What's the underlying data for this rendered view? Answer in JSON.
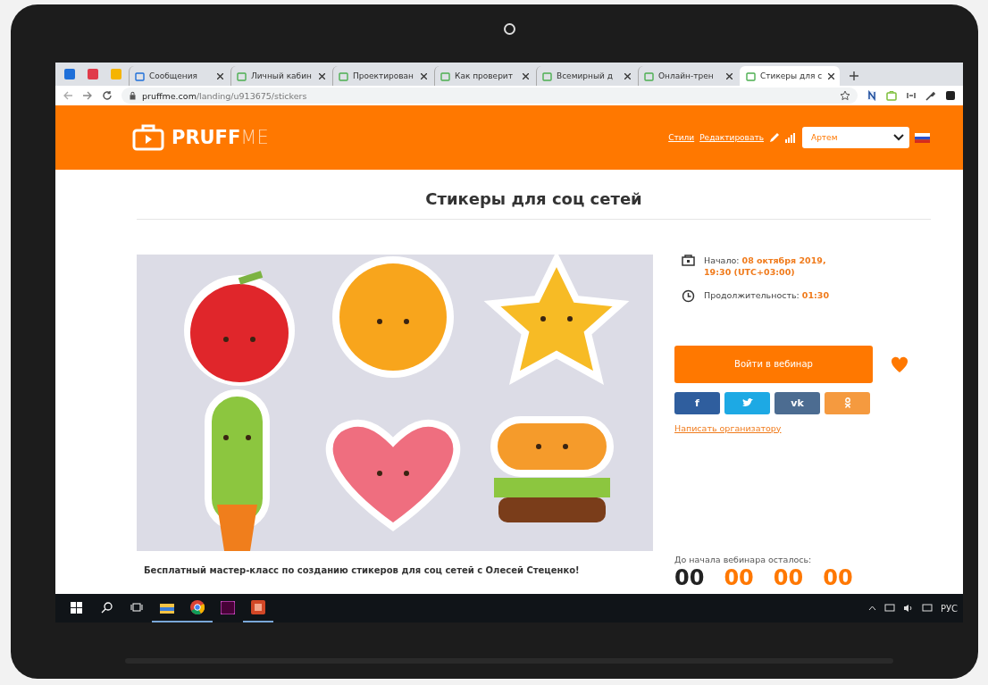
{
  "browser": {
    "tabs": [
      {
        "title": "Сообщения",
        "selected": false
      },
      {
        "title": "Личный кабин",
        "selected": false
      },
      {
        "title": "Проектирован",
        "selected": false
      },
      {
        "title": "Как проверит",
        "selected": false
      },
      {
        "title": "Всемирный д",
        "selected": false
      },
      {
        "title": "Онлайн-трен",
        "selected": false
      },
      {
        "title": "Стикеры для с",
        "selected": true
      }
    ],
    "url_host": "pruffme.com",
    "url_path": "/landing/u913675/stickers"
  },
  "header": {
    "logo_bold": "PRUFF",
    "logo_light": "ME",
    "links": [
      "Стили",
      "Редактировать"
    ],
    "user_select": "Артем"
  },
  "page": {
    "title": "Стикеры для соц сетей",
    "start_label": "Начало:",
    "start_value": "08 октября 2019, 19:30 (UTC+03:00)",
    "duration_label": "Продолжительность:",
    "duration_value": "01:30",
    "join_button": "Войти в вебинар",
    "share": [
      {
        "kind": "facebook",
        "label": "f"
      },
      {
        "kind": "twitter"
      },
      {
        "kind": "vk",
        "label": "vk"
      },
      {
        "kind": "ok"
      }
    ],
    "contact_link": "Написать организатору",
    "caption": "Бесплатный мастер-класс по созданию стикеров для соц сетей с Олесей Стеценко!",
    "countdown_label": "До начала вебинара осталось:",
    "countdown": [
      "00",
      "00",
      "00",
      "00"
    ]
  },
  "taskbar": {
    "language": "РУС"
  }
}
